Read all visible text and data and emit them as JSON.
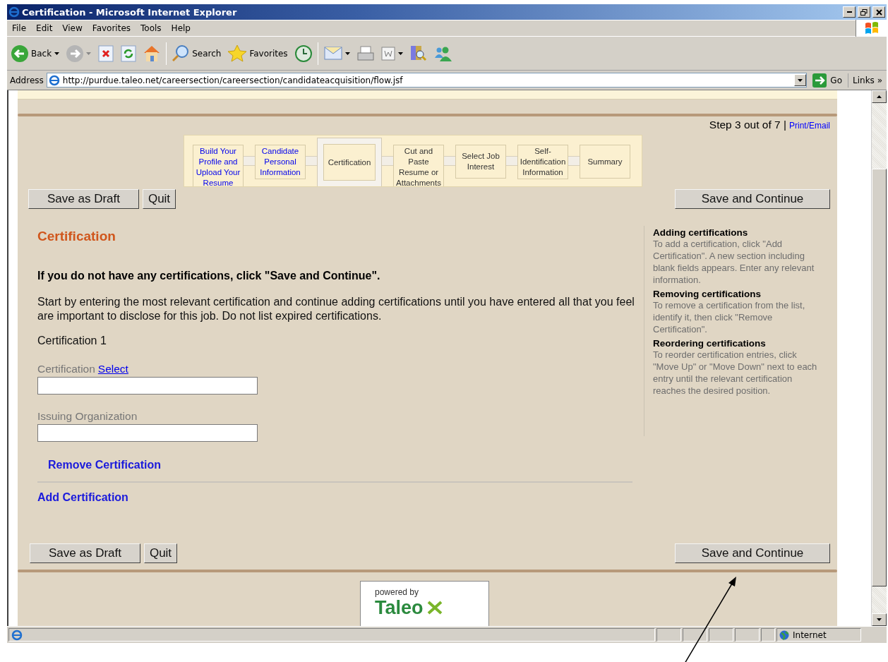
{
  "window": {
    "title": "Certification - Microsoft Internet Explorer"
  },
  "menu": [
    "File",
    "Edit",
    "View",
    "Favorites",
    "Tools",
    "Help"
  ],
  "toolbar": {
    "back": "Back",
    "search": "Search",
    "favorites": "Favorites"
  },
  "address_bar": {
    "label": "Address",
    "url": "http://purdue.taleo.net/careersection/careersection/candidateacquisition/flow.jsf",
    "go": "Go",
    "links": "Links",
    "more": "»"
  },
  "page": {
    "step_text": "Step 3 out of 7 |",
    "print_link": "Print/Email",
    "steps": [
      {
        "label": "Build Your Profile and Upload Your Resume",
        "done": true,
        "selected": false
      },
      {
        "label": "Candidate Personal Information",
        "done": true,
        "selected": false
      },
      {
        "label": "Certification",
        "done": false,
        "selected": true
      },
      {
        "label": "Cut and Paste Resume or Attachments",
        "done": false,
        "selected": false
      },
      {
        "label": "Select Job Interest",
        "done": false,
        "selected": false
      },
      {
        "label": "Self-Identification Information",
        "done": false,
        "selected": false
      },
      {
        "label": "Summary",
        "done": false,
        "selected": false
      }
    ],
    "top_buttons": {
      "draft": "Save as Draft",
      "quit": "Quit",
      "continue": "Save and Continue"
    },
    "heading": "Certification",
    "instruction": "If you do not have any certifications, click \"Save and Continue\".",
    "intro": "Start by entering the most relevant certification and continue adding certifications until you have entered all that you feel are important to disclose for this job. Do not list expired certifications.",
    "entry_title": "Certification 1",
    "fields": [
      {
        "label": "Certification",
        "link": "Select"
      },
      {
        "label": "Issuing Organization"
      }
    ],
    "remove_link": "Remove Certification",
    "add_link": "Add Certification",
    "bottom_buttons": {
      "draft": "Save as Draft",
      "quit": "Quit",
      "continue": "Save and Continue"
    },
    "help": [
      {
        "title": "Adding certifications",
        "text": "To add a certification, click \"Add Certification\". A new section including blank fields appears. Enter any relevant information."
      },
      {
        "title": "Removing certifications",
        "text": "To remove a certification from the list, identify it, then click \"Remove Certification\"."
      },
      {
        "title": "Reordering certifications",
        "text": "To reorder certification entries, click \"Move Up\" or \"Move Down\" next to each entry until the relevant certification reaches the desired position."
      }
    ],
    "footer": {
      "powered": "powered by",
      "brand": "Taleo"
    }
  },
  "status_bar": {
    "zone": "Internet"
  }
}
